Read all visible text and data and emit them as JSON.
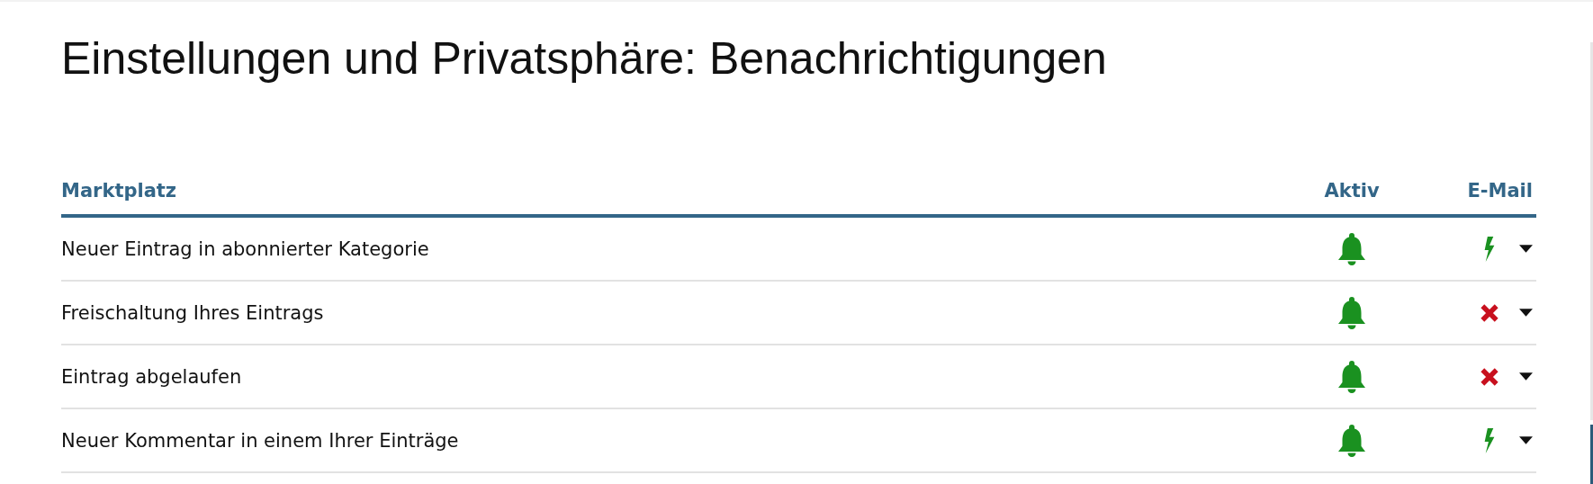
{
  "title": "Einstellungen und Privatsphäre: Benachrichtigungen",
  "table": {
    "columns": [
      "Marktplatz",
      "Aktiv",
      "E-Mail"
    ],
    "rows": [
      {
        "label": "Neuer Eintrag in abonnierter Kategorie",
        "active": true,
        "email_on": true
      },
      {
        "label": "Freischaltung Ihres Eintrags",
        "active": true,
        "email_on": false
      },
      {
        "label": "Eintrag abgelaufen",
        "active": true,
        "email_on": false
      },
      {
        "label": "Neuer Kommentar in einem Ihrer Einträge",
        "active": true,
        "email_on": true
      }
    ]
  }
}
